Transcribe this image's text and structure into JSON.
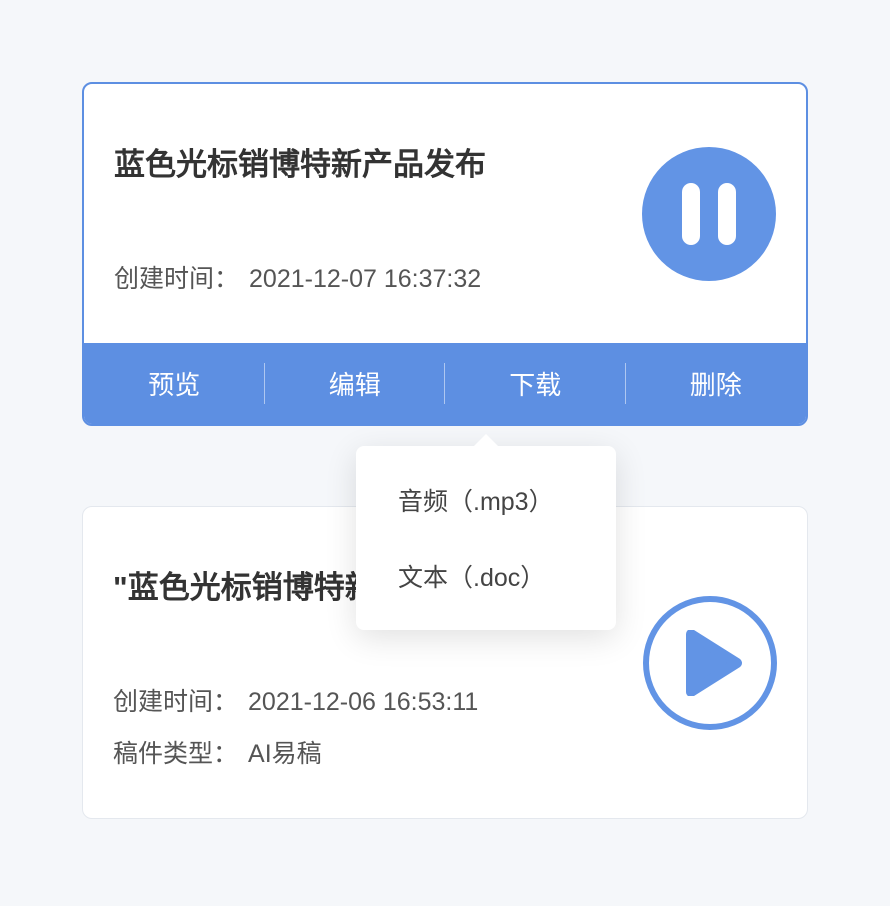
{
  "cards": [
    {
      "title": "蓝色光标销博特新产品发布",
      "created_label": "创建时间：",
      "created_time": "2021-12-07 16:37:32",
      "media_state": "pause",
      "actions": {
        "preview": "预览",
        "edit": "编辑",
        "download": "下载",
        "delete": "删除"
      },
      "download_dropdown": [
        "音频（.mp3）",
        "文本（.doc）"
      ]
    },
    {
      "title": "\"蓝色光标销博特新功能发布会",
      "created_label": "创建时间：",
      "created_time": "2021-12-06 16:53:11",
      "doc_type_label": "稿件类型：",
      "doc_type": "AI易稿",
      "media_state": "play"
    }
  ]
}
